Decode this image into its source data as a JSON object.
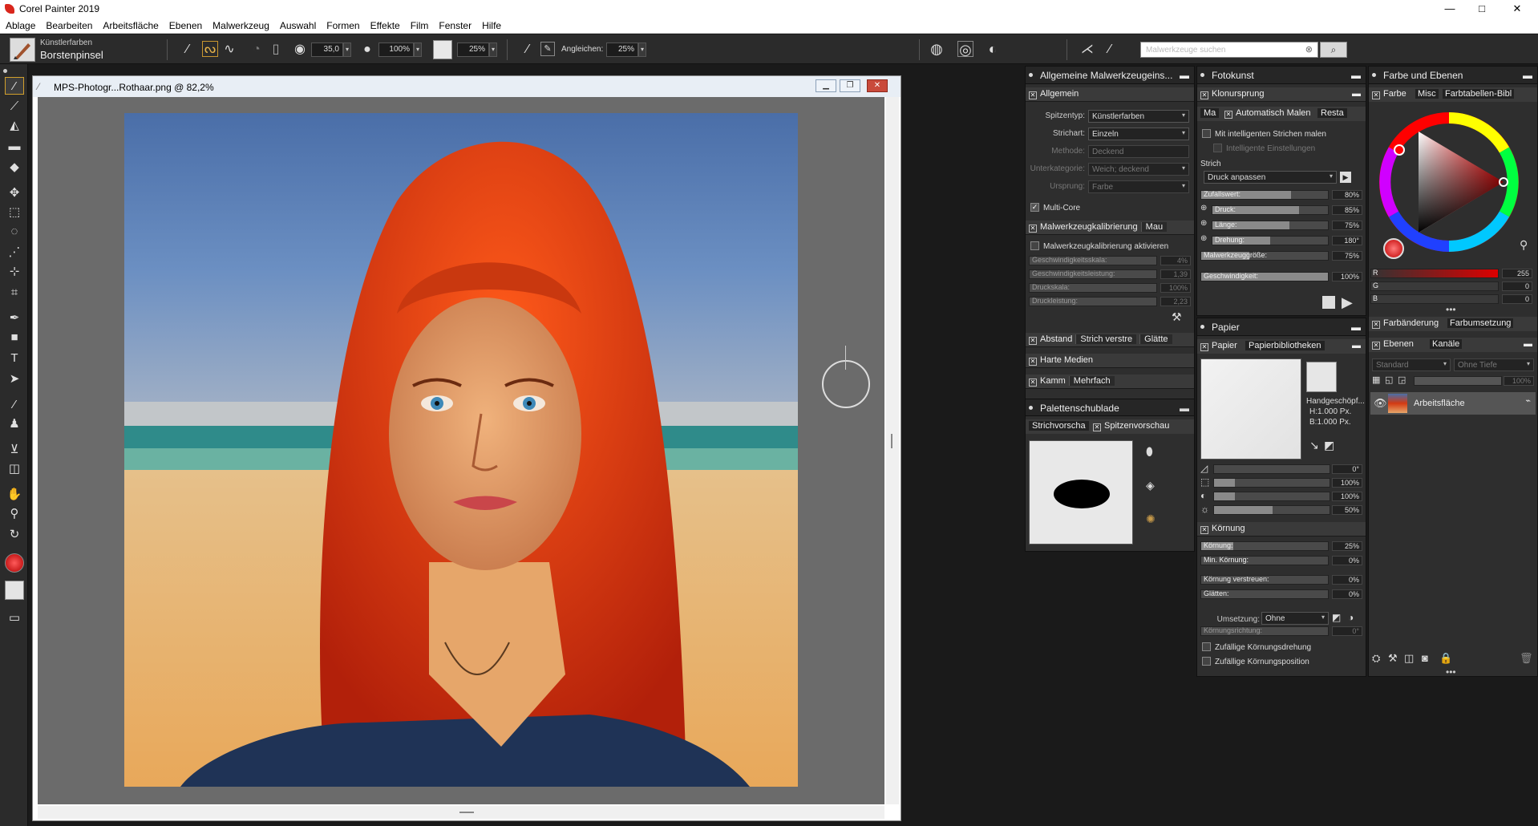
{
  "app": {
    "title": "Corel Painter 2019"
  },
  "window": {
    "minimize": "—",
    "maximize": "□",
    "close": "✕"
  },
  "menu": [
    "Ablage",
    "Bearbeiten",
    "Arbeitsfläche",
    "Ebenen",
    "Malwerkzeug",
    "Auswahl",
    "Formen",
    "Effekte",
    "Film",
    "Fenster",
    "Hilfe"
  ],
  "propbar": {
    "brush_category": "Künstlerfarben",
    "brush_variant": "Borstenpinsel",
    "size": "35,0",
    "opacity": "100%",
    "grain": "25%",
    "match_label": "Angleichen:",
    "match": "25%",
    "search_placeholder": "Malwerkzeuge suchen"
  },
  "document": {
    "title": "MPS-Photogr...Rothaar.png @ 82,2%"
  },
  "general_panel": {
    "title": "Allgemeine Malwerkzeugeins...",
    "section": "Allgemein",
    "rows": [
      {
        "label": "Spitzentyp:",
        "value": "Künstlerfarben"
      },
      {
        "label": "Strichart:",
        "value": "Einzeln"
      },
      {
        "label": "Methode:",
        "value": "Deckend"
      },
      {
        "label": "Unterkategorie:",
        "value": "Weich; deckend"
      },
      {
        "label": "Ursprung:",
        "value": "Farbe"
      }
    ],
    "multicore": "Multi-Core",
    "calib_tab": "Malwerkzeugkalibrierung",
    "calib_tab2": "Mau",
    "calib_enable": "Malwerkzeugkalibrierung aktivieren",
    "calib_rows": [
      {
        "label": "Geschwindigkeitsskala:",
        "value": "4%"
      },
      {
        "label": "Geschwindigkeitsleistung:",
        "value": "1,39"
      },
      {
        "label": "Druckskala:",
        "value": "100%"
      },
      {
        "label": "Druckleistung:",
        "value": "2,23"
      }
    ],
    "spacing_tabs": [
      "Abstand",
      "Strich verstre",
      "Glätte"
    ],
    "hard_media": "Harte Medien",
    "comb_tabs": [
      "Kamm",
      "Mehrfach"
    ]
  },
  "drawer": {
    "title": "Palettenschublade",
    "tabs": [
      "Strichvorscha",
      "Spitzenvorschau"
    ]
  },
  "photo_panel": {
    "title": "Fotokunst",
    "section": "Klonursprung",
    "tabs": [
      "Ma",
      "Automatisch Malen",
      "Resta"
    ],
    "smart": "Mit intelligenten Strichen malen",
    "smart_settings": "Intelligente Einstellungen",
    "stroke_label": "Strich",
    "stroke_value": "Druck anpassen",
    "sliders": [
      {
        "label": "Zufallswert:",
        "value": "80%",
        "fill": 0.8
      },
      {
        "label": "Druck:",
        "value": "85%",
        "fill": 0.85
      },
      {
        "label": "Länge:",
        "value": "75%",
        "fill": 0.75
      },
      {
        "label": "Drehung:",
        "value": "180°",
        "fill": 0.5
      },
      {
        "label": "Malwerkzeuggröße:",
        "value": "75%",
        "fill": 0.37
      }
    ],
    "speed_label": "Geschwindigkeit:",
    "speed_value": "100%"
  },
  "paper_panel": {
    "title": "Papier",
    "tabs": [
      "Papier",
      "Papierbibliotheken"
    ],
    "paper_name": "Handgeschöpf...",
    "paper_h": "H:1.000 Px.",
    "paper_w": "B:1.000 Px.",
    "values": [
      {
        "value": "0°",
        "fill": 0
      },
      {
        "value": "100%",
        "fill": 0.18
      },
      {
        "value": "100%",
        "fill": 0.18
      },
      {
        "value": "50%",
        "fill": 0.5
      }
    ],
    "grain_section": "Körnung",
    "grain_rows": [
      {
        "label": "Körnung:",
        "value": "25%"
      },
      {
        "label": "Min. Körnung:",
        "value": "0%"
      },
      {
        "label": "Körnung verstreuen:",
        "value": "0%"
      },
      {
        "label": "Glätten:",
        "value": "0%"
      }
    ],
    "conversion_label": "Umsetzung:",
    "conversion_value": "Ohne",
    "grain_dir": "Körnungsrichtung:",
    "grain_dir_value": "0°",
    "random_rot": "Zufällige Körnungsdrehung",
    "random_pos": "Zufällige Körnungsposition"
  },
  "color_panel": {
    "title": "Farbe und Ebenen",
    "tabs": [
      "Farbe",
      "Misc",
      "Farbtabellen-Bibl"
    ],
    "rgb": [
      {
        "label": "R",
        "value": "255",
        "fill": 1
      },
      {
        "label": "G",
        "value": "0",
        "fill": 0
      },
      {
        "label": "B",
        "value": "0",
        "fill": 0
      }
    ],
    "mix_tabs": [
      "Farbänderung",
      "Farbumsetzung"
    ],
    "layer_tabs": [
      "Ebenen",
      "Kanäle"
    ],
    "blend": "Standard",
    "depth": "Ohne Tiefe",
    "opacity": "100%",
    "layer_name": "Arbeitsfläche"
  },
  "colors": {
    "accent": "#ff0000",
    "panel": "#2e2e2e",
    "canvas_bg": "#6b6b6b"
  }
}
